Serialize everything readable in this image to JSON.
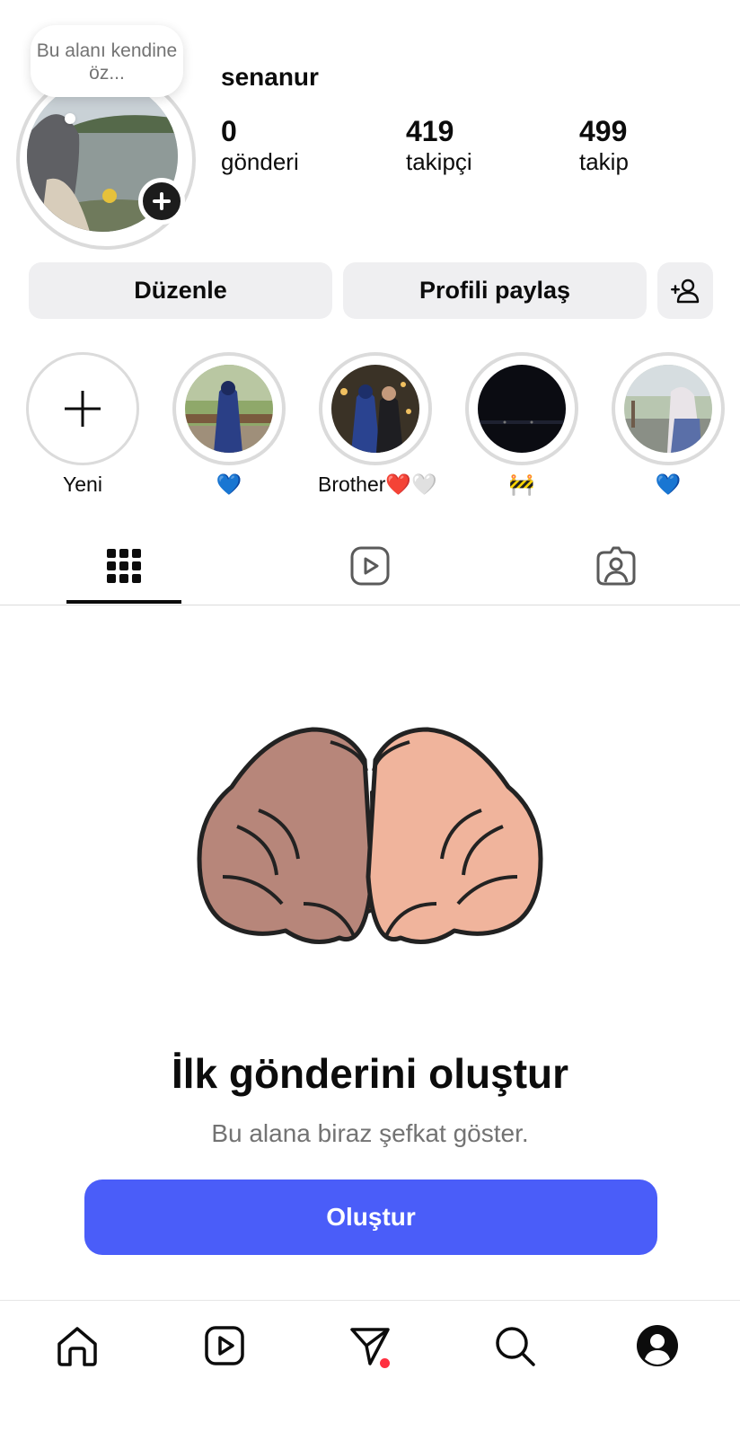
{
  "profile": {
    "note": "Bu alanı kendine öz...",
    "username": "senanur",
    "stats": [
      {
        "value": "0",
        "label": "gönderi"
      },
      {
        "value": "419",
        "label": "takipçi"
      },
      {
        "value": "499",
        "label": "takip"
      }
    ]
  },
  "actions": {
    "edit_label": "Düzenle",
    "share_label": "Profili paylaş"
  },
  "highlights": [
    {
      "label": "Yeni"
    },
    {
      "label": "💙"
    },
    {
      "label": "Brother❤️🤍"
    },
    {
      "label": "🚧"
    },
    {
      "label": "💙"
    }
  ],
  "tabs": [
    "grid-icon",
    "reels-icon",
    "tagged-icon"
  ],
  "empty_state": {
    "title": "İlk gönderini oluştur",
    "subtitle": "Bu alana biraz şefkat göster.",
    "button_label": "Oluştur"
  },
  "bottom_nav": [
    "home-icon",
    "reels-icon",
    "direct-icon",
    "search-icon",
    "profile-icon"
  ],
  "colors": {
    "accent": "#4a5df9",
    "button_bg": "#efeff1",
    "notification_dot": "#ff3040",
    "muted_text": "#737373"
  }
}
